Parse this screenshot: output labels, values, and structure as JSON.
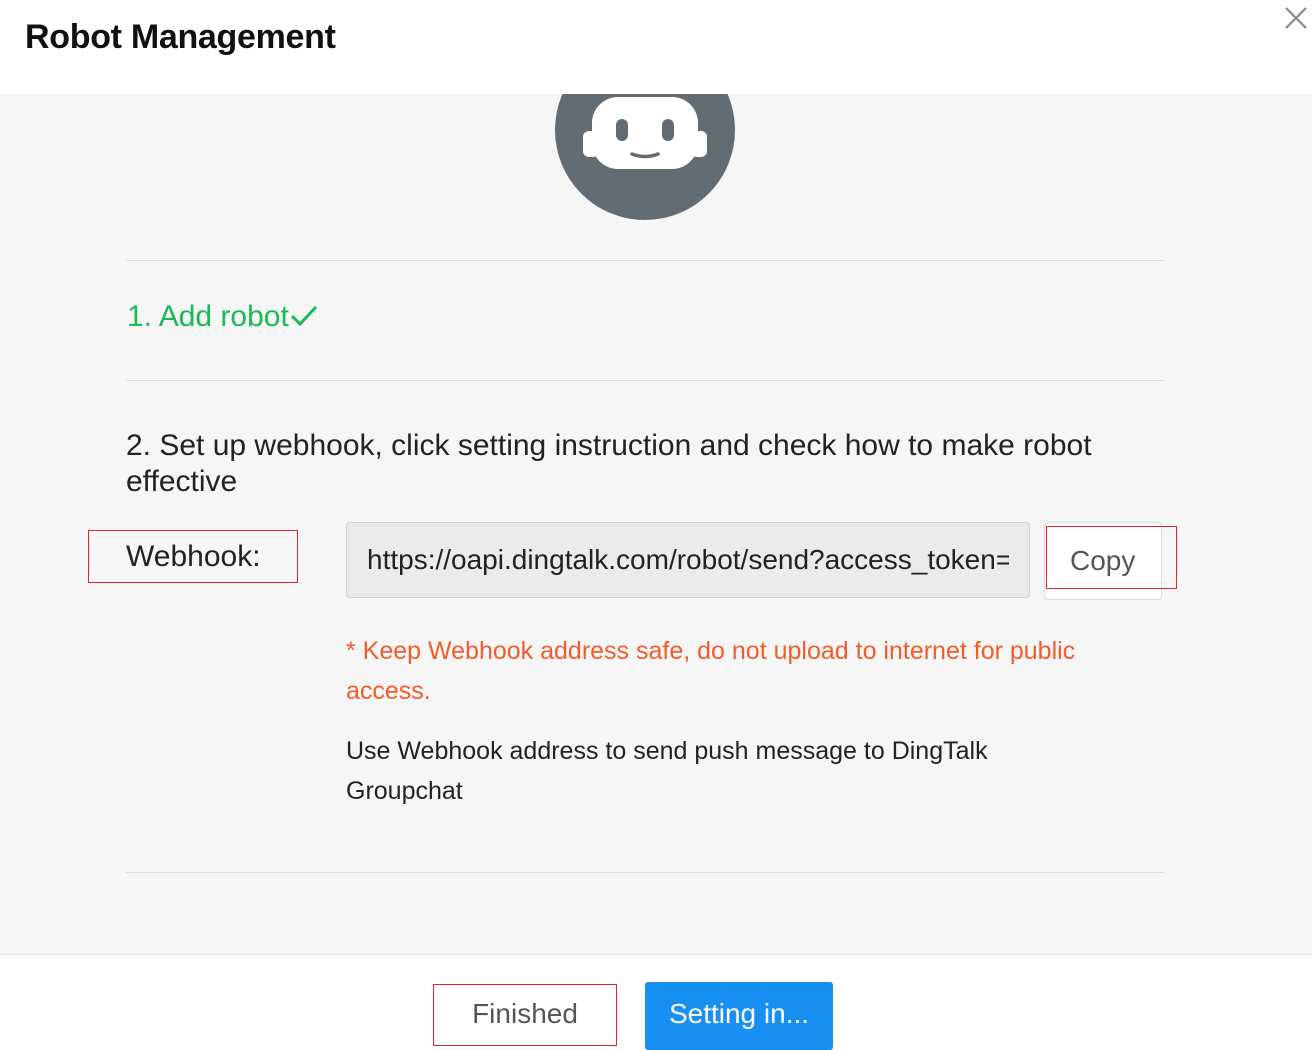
{
  "dialog": {
    "title": "Robot Management",
    "close_icon": "close-icon"
  },
  "body": {
    "avatar_icon": "robot-avatar-icon",
    "step1": {
      "label": "1. Add robot",
      "status_icon": "checkmark-icon",
      "color": "#19b955"
    },
    "step2": {
      "label": "2. Set up webhook, click setting instruction and check how to make robot effective"
    },
    "webhook": {
      "label": "Webhook:",
      "value": "https://oapi.dingtalk.com/robot/send?access_token=",
      "copy_label": "Copy"
    },
    "warning": {
      "text": "* Keep Webhook address safe, do not upload to internet for public access.",
      "color": "#f25c2a"
    },
    "description": "Use Webhook address to send push message to DingTalk Groupchat"
  },
  "footer": {
    "finished_label": "Finished",
    "setting_label": "Setting in...",
    "primary_color": "#1890f2"
  }
}
